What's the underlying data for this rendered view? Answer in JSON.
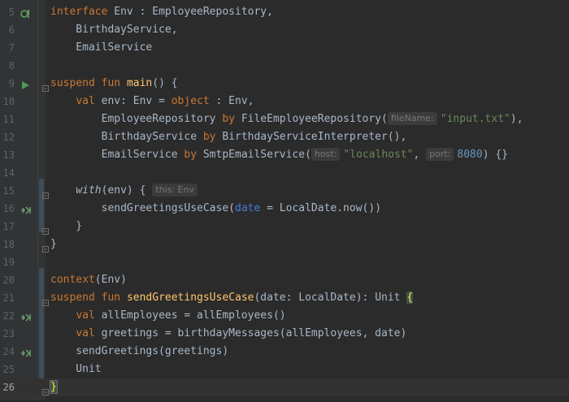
{
  "lines": [
    {
      "n": "5"
    },
    {
      "n": "6"
    },
    {
      "n": "7"
    },
    {
      "n": "8"
    },
    {
      "n": "9"
    },
    {
      "n": "10"
    },
    {
      "n": "11"
    },
    {
      "n": "12"
    },
    {
      "n": "13"
    },
    {
      "n": "14"
    },
    {
      "n": "15"
    },
    {
      "n": "16"
    },
    {
      "n": "17"
    },
    {
      "n": "18"
    },
    {
      "n": "19"
    },
    {
      "n": "20"
    },
    {
      "n": "21"
    },
    {
      "n": "22"
    },
    {
      "n": "23"
    },
    {
      "n": "24"
    },
    {
      "n": "25"
    },
    {
      "n": "26"
    }
  ],
  "code": {
    "l5": {
      "kw": "interface",
      "rest": " Env : EmployeeRepository,"
    },
    "l6": {
      "text": "    BirthdayService,"
    },
    "l7": {
      "text": "    EmailService"
    },
    "l9": {
      "kw1": "suspend",
      "kw2": "fun",
      "fn": "main",
      "rest": "() {"
    },
    "l10": {
      "indent": "    ",
      "kw": "val",
      "mid": " env: Env = ",
      "kw2": "object",
      "rest": " : Env,"
    },
    "l11": {
      "indent": "        ",
      "a": "EmployeeRepository ",
      "kw": "by",
      "b": " FileEmployeeRepository(",
      "hint": "fileName:",
      "str": "\"input.txt\"",
      "c": "),"
    },
    "l12": {
      "indent": "        ",
      "a": "BirthdayService ",
      "kw": "by",
      "b": " BirthdayServiceInterpreter(),"
    },
    "l13": {
      "indent": "        ",
      "a": "EmailService ",
      "kw": "by",
      "b": " SmtpEmailService(",
      "hint1": "host:",
      "str": "\"localhost\"",
      "c": ", ",
      "hint2": "port:",
      "num": "8080",
      "d": ") {}"
    },
    "l15": {
      "indent": "    ",
      "kw": "with",
      "b": "(env) {",
      "hint": "this: Env"
    },
    "l16": {
      "indent": "        ",
      "a": "sendGreetingsUseCase(",
      "named": "date",
      "b": " = LocalDate.now())"
    },
    "l17": {
      "text": "    }"
    },
    "l19": {
      "text": "}"
    },
    "l20": {
      "kw": "context",
      "rest": "(Env)"
    },
    "l21": {
      "kw1": "suspend",
      "kw2": "fun",
      "fn": "sendGreetingsUseCase",
      "rest": "(date: LocalDate): Unit ",
      "brace": "{"
    },
    "l22": {
      "indent": "    ",
      "kw": "val",
      "rest": " allEmployees = allEmployees()"
    },
    "l23": {
      "indent": "    ",
      "kw": "val",
      "rest": " greetings = birthdayMessages(allEmployees, date)"
    },
    "l24": {
      "text": "    sendGreetings(greetings)"
    },
    "l25": {
      "text": "    Unit"
    },
    "l26": {
      "brace": "}"
    }
  }
}
